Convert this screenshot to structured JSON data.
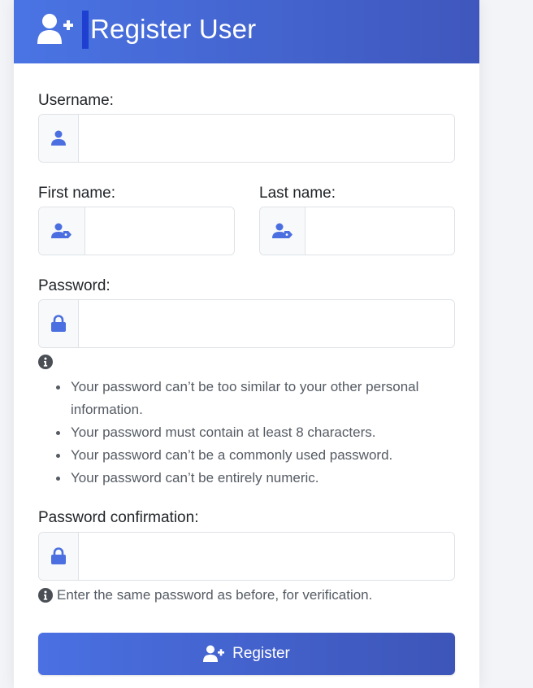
{
  "header": {
    "title": "Register User",
    "icon": "user-plus-icon",
    "gradient": [
      "#4a74e4",
      "#3f57bd"
    ]
  },
  "form": {
    "username": {
      "label": "Username:",
      "value": "",
      "icon": "user-icon"
    },
    "first_name": {
      "label": "First name:",
      "value": "",
      "icon": "user-tag-icon"
    },
    "last_name": {
      "label": "Last name:",
      "value": "",
      "icon": "user-tag-icon"
    },
    "password": {
      "label": "Password:",
      "value": "",
      "icon": "lock-icon",
      "help": [
        "Your password can’t be too similar to your other personal information.",
        "Your password must contain at least 8 characters.",
        "Your password can’t be a commonly used password.",
        "Your password can’t be entirely numeric."
      ]
    },
    "password_confirmation": {
      "label": "Password confirmation:",
      "value": "",
      "icon": "lock-icon",
      "help": "Enter the same password as before, for verification."
    },
    "submit_label": "Register"
  },
  "colors": {
    "accent": "#4b6fe0",
    "help_text": "#555b63"
  }
}
